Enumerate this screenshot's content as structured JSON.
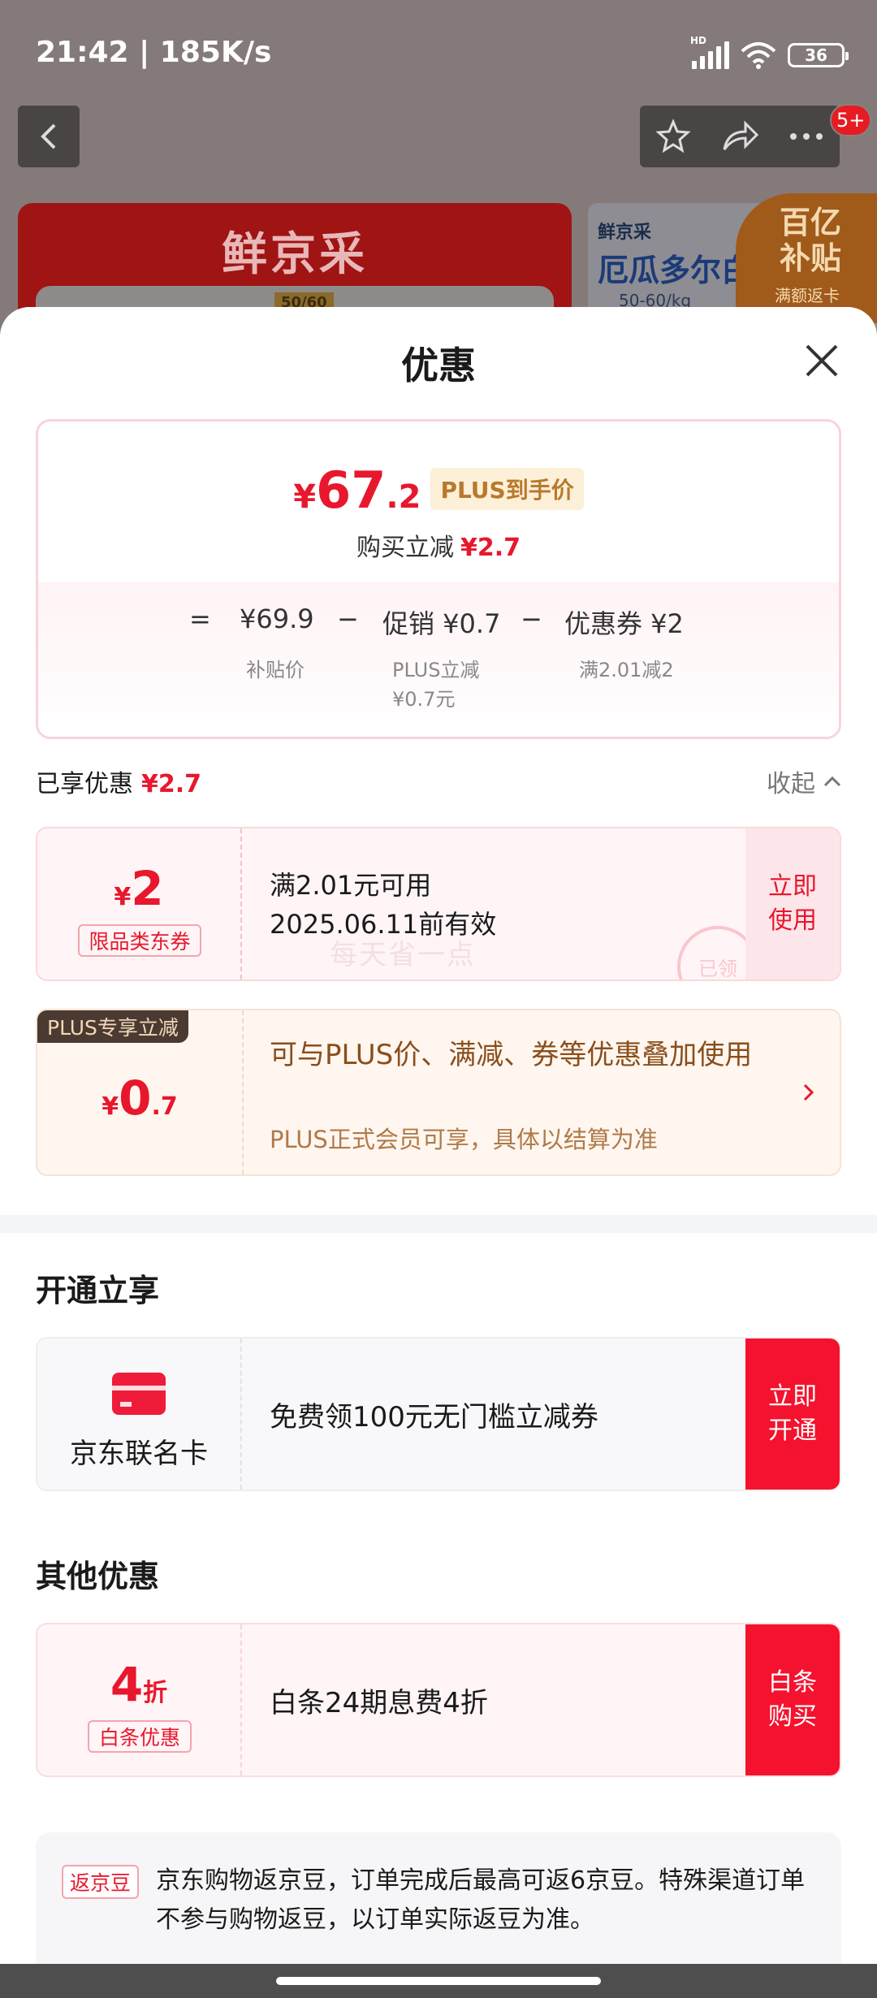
{
  "status_bar": {
    "time": "21:42 | 185K/s",
    "network": "HD",
    "battery": "36"
  },
  "background": {
    "badge": "5+",
    "left_brand": "鲜京采",
    "left_tag": "50/60",
    "right_brand": "鲜京采",
    "right_title": "厄瓜多尔白",
    "right_spec": "50-60/kg",
    "subsidy_title": "百亿补贴",
    "subsidy_sub": "满额返卡"
  },
  "sheet": {
    "title": "优惠",
    "price_card": {
      "currency": "¥",
      "price_int": "67",
      "price_dec": ".2",
      "plus_tag": "PLUS到手价",
      "buy_discount_label": "购买立减",
      "buy_discount_value": "¥2.7",
      "eq": "=",
      "base_price": "¥69.9",
      "minus1": "−",
      "promo": "促销 ¥0.7",
      "minus2": "−",
      "coupon": "优惠券 ¥2",
      "base_price_label": "补贴价",
      "promo_label_1": "PLUS立减",
      "promo_label_2": "¥0.7元",
      "coupon_label": "满2.01减2"
    },
    "enjoyed_label": "已享优惠",
    "enjoyed_value": "¥2.7",
    "collapse_label": "收起",
    "coupon1": {
      "currency": "¥",
      "amount": "2",
      "tag": "限品类东券",
      "line1": "满2.01元可用",
      "line2": "2025.06.11前有效",
      "action_1": "立即",
      "action_2": "使用",
      "watermark": "每天省一点",
      "stamp": "已领"
    },
    "plus_offer": {
      "label": "PLUS专享立减",
      "currency": "¥",
      "amount_int": "0",
      "amount_dec": ".7",
      "title": "可与PLUS价、满减、券等优惠叠加使用",
      "desc": "PLUS正式会员可享，具体以结算为准"
    },
    "open_section_title": "开通立享",
    "card_offer": {
      "name": "京东联名卡",
      "text": "免费领100元无门槛立减券",
      "action_1": "立即",
      "action_2": "开通"
    },
    "other_section_title": "其他优惠",
    "baitiao_offer": {
      "amount": "4",
      "unit": "折",
      "tag": "白条优惠",
      "text": "白条24期息费4折",
      "action_1": "白条",
      "action_2": "购买"
    },
    "bean": {
      "tag": "返京豆",
      "text": "京东购物返京豆，订单完成后最高可返6京豆。特殊渠道订单不参与购物返豆，以订单实际返豆为准。"
    }
  },
  "colors": {
    "accent_red": "#e8172d",
    "button_red": "#f5122e",
    "plus_brown": "#8a4e1c"
  }
}
